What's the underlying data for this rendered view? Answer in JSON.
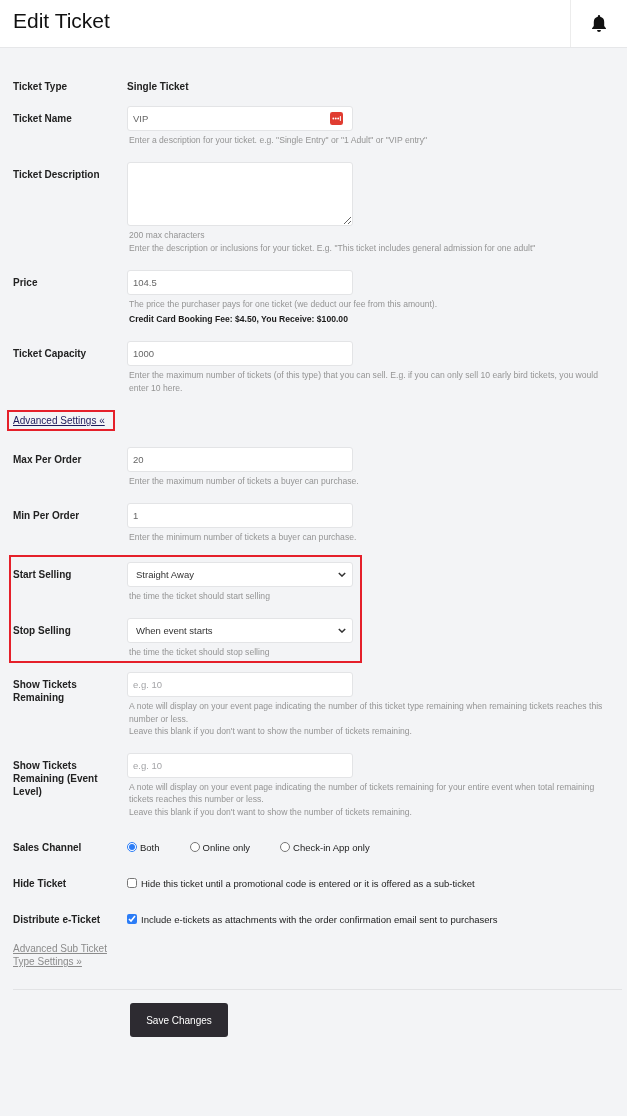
{
  "header": {
    "title": "Edit Ticket"
  },
  "form": {
    "rows": [
      {
        "kind": "static",
        "label": "Ticket Type",
        "value": "Single Ticket"
      },
      {
        "kind": "text",
        "label": "Ticket Name",
        "value": "VIP",
        "autofill_badge": true,
        "help": [
          "Enter a description for your ticket. e.g. \"Single Entry\" or \"1 Adult\" or \"VIP entry\""
        ]
      },
      {
        "kind": "textarea",
        "label": "Ticket Description",
        "help": [
          "200 max characters",
          "Enter the description or inclusions for your ticket. E.g. \"This ticket includes general admission for one adult\""
        ]
      },
      {
        "kind": "text",
        "label": "Price",
        "value": "104.5",
        "help": [
          "The price the purchaser pays for one ticket (we deduct our fee from this amount)."
        ],
        "note": "Credit Card Booking Fee: $4.50, You Receive: $100.00"
      },
      {
        "kind": "text",
        "label": "Ticket Capacity",
        "value": "1000",
        "help": [
          "Enter the maximum number of tickets (of this type) that you can sell. E.g. if you can only sell 10 early bird tickets, you would enter 10 here."
        ]
      },
      {
        "kind": "link",
        "label": "Advanced Settings «",
        "highlighted": true
      },
      {
        "kind": "text",
        "label": "Max Per Order",
        "value": "20",
        "help": [
          "Enter the maximum number of tickets a buyer can purchase."
        ]
      },
      {
        "kind": "text",
        "label": "Min Per Order",
        "value": "1",
        "help": [
          "Enter the minimum number of tickets a buyer can purchase."
        ]
      },
      {
        "kind": "group",
        "highlighted": true,
        "rows": [
          {
            "kind": "select",
            "label": "Start Selling",
            "value": "Straight Away",
            "help": [
              "the time the ticket should start selling"
            ]
          },
          {
            "kind": "select",
            "label": "Stop Selling",
            "value": "When event starts",
            "help": [
              "the time the ticket should stop selling"
            ]
          }
        ]
      },
      {
        "kind": "text",
        "label": "Show Tickets Remaining",
        "placeholder": "e.g. 10",
        "help": [
          "A note will display on your event page indicating the number of this ticket type remaining when remaining tickets reaches this number or less.",
          "Leave this blank if you don't want to show the number of tickets remaining."
        ]
      },
      {
        "kind": "text",
        "label": "Show Tickets Remaining (Event Level)",
        "placeholder": "e.g. 10",
        "help": [
          "A note will display on your event page indicating the number of tickets remaining for your entire event when total remaining tickets reaches this number or less.",
          "Leave this blank if you don't want to show the number of tickets remaining."
        ]
      },
      {
        "kind": "radio",
        "label": "Sales Channel",
        "options": [
          {
            "label": "Both",
            "selected": true
          },
          {
            "label": "Online only",
            "selected": false
          },
          {
            "label": "Check-in App only",
            "selected": false
          }
        ]
      },
      {
        "kind": "checkbox",
        "label": "Hide Ticket",
        "text": "Hide this ticket until a promotional code is entered or it is offered as a sub-ticket",
        "checked": false
      },
      {
        "kind": "checkbox",
        "label": "Distribute e-Ticket",
        "text": "Include e-tickets as attachments with the order confirmation email sent to purchasers",
        "checked": true
      },
      {
        "kind": "sublink",
        "label": "Advanced Sub Ticket Type Settings »"
      }
    ]
  },
  "save_button": {
    "label": "Save Changes"
  }
}
